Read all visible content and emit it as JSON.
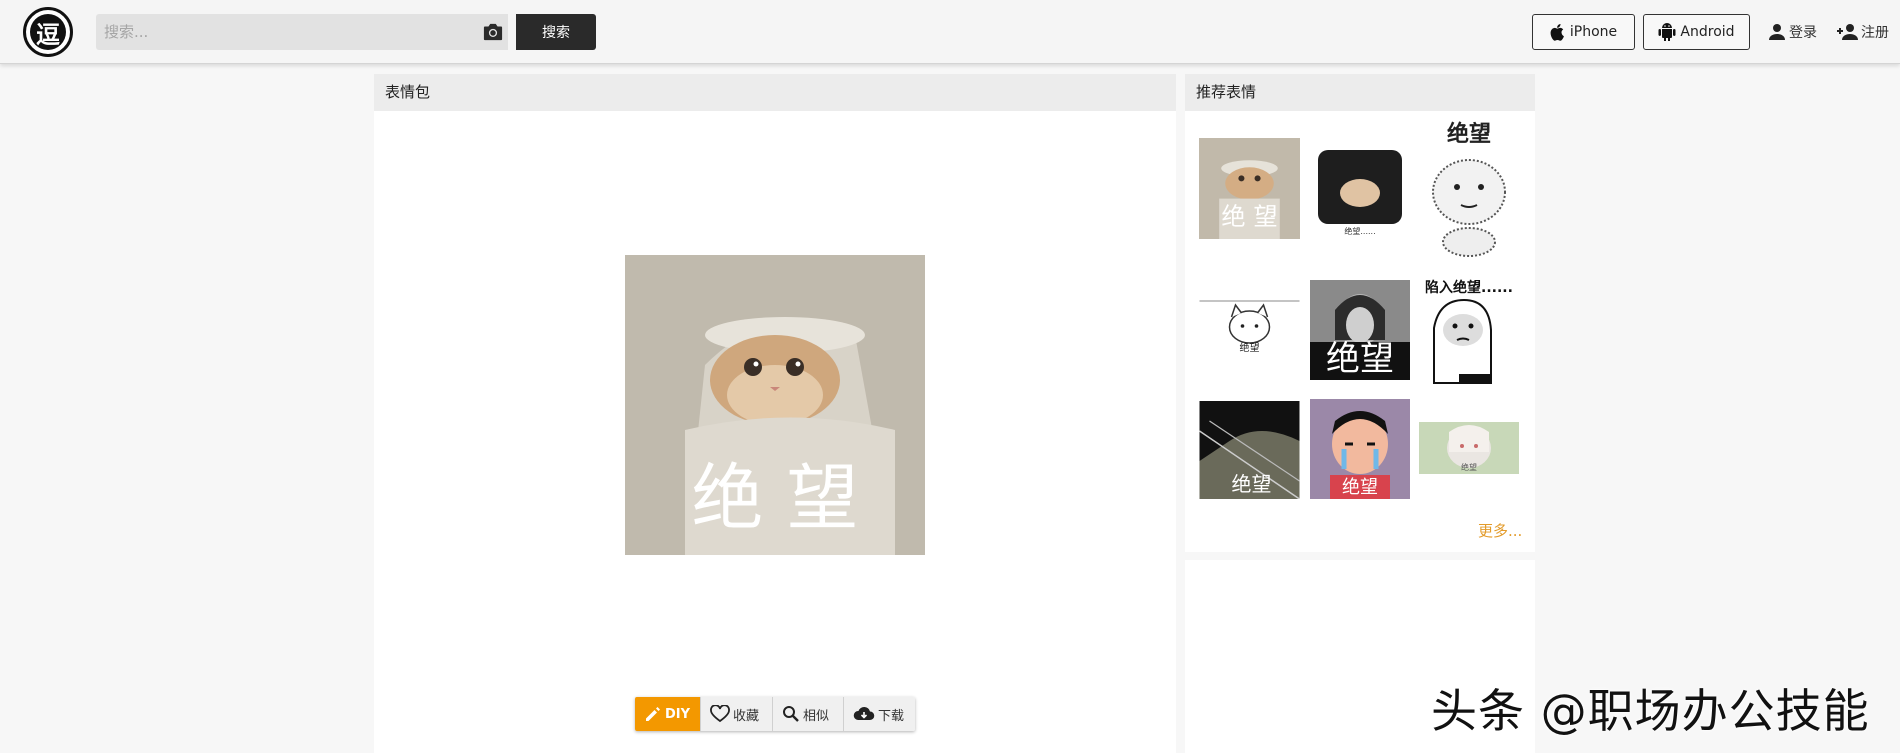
{
  "header": {
    "logo_glyph": "逗",
    "search": {
      "placeholder": "搜索...",
      "value": ""
    },
    "search_button": "搜索",
    "iphone_label": "iPhone",
    "android_label": "Android",
    "login_label": "登录",
    "register_label": "注册"
  },
  "main": {
    "title": "表情包",
    "image_caption": "绝 望",
    "actions": {
      "diy": "DIY",
      "favorite": "收藏",
      "similar": "相似",
      "download": "下载"
    }
  },
  "sidebar": {
    "title": "推荐表情",
    "items": [
      {
        "caption": "绝 望"
      },
      {
        "caption": "绝望......"
      },
      {
        "caption": "绝望"
      },
      {
        "caption": "绝望"
      },
      {
        "caption": "绝望"
      },
      {
        "caption": "陷入绝望......"
      },
      {
        "caption": "绝望"
      },
      {
        "caption": "绝望"
      },
      {
        "caption": "绝望"
      }
    ],
    "more_label": "更多..."
  },
  "watermark": "头条 @职场办公技能",
  "colors": {
    "accent": "#f39800",
    "dark": "#2a2a2a",
    "more_link": "#e39b2a"
  }
}
